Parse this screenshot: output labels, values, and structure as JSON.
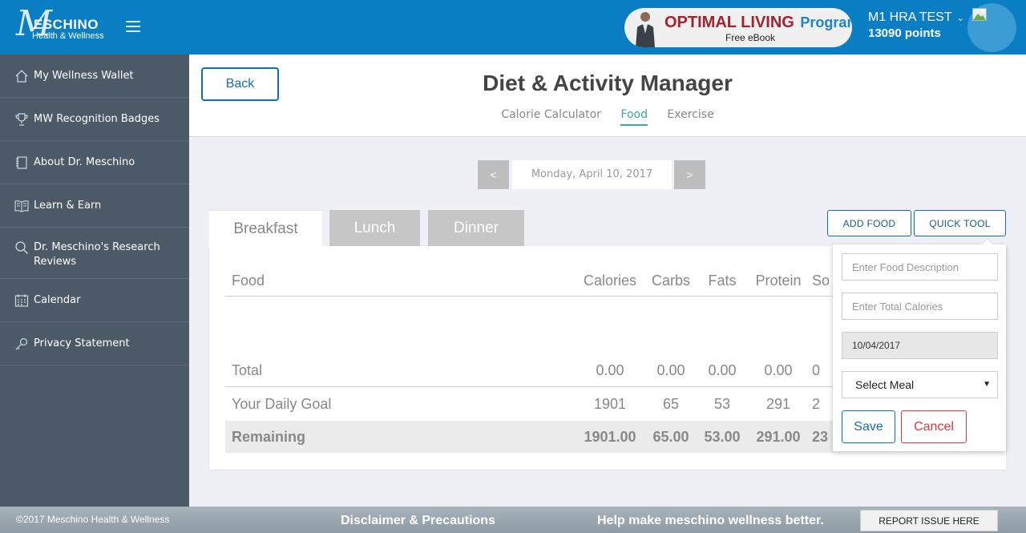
{
  "header": {
    "logo_brand": "ESCHINO",
    "logo_initial": "M",
    "logo_sub": "Health & Wellness",
    "promo_title": "OPTIMAL LIVING",
    "promo_program": "Program",
    "promo_ebook": "Free eBook",
    "user_name": "M1 HRA TEST",
    "user_points": "13090 points"
  },
  "sidebar": {
    "items": [
      {
        "label": "My Wellness Wallet",
        "icon": "home-icon"
      },
      {
        "label": "MW Recognition Badges",
        "icon": "trophy-icon"
      },
      {
        "label": "About Dr. Meschino",
        "icon": "book-icon"
      },
      {
        "label": "Learn & Earn",
        "icon": "open-book-icon"
      },
      {
        "label": "Dr. Meschino's Research Reviews",
        "icon": "search-icon"
      },
      {
        "label": "Calendar",
        "icon": "calendar-icon"
      },
      {
        "label": "Privacy Statement",
        "icon": "key-icon"
      }
    ]
  },
  "page": {
    "back_label": "Back",
    "title": "Diet & Activity Manager",
    "tabs": [
      "Calorie Calculator",
      "Food",
      "Exercise"
    ],
    "active_tab": "Food"
  },
  "date_nav": {
    "prev": "<",
    "next": ">",
    "date": "Monday, April 10, 2017"
  },
  "meals": {
    "tabs": [
      "Breakfast",
      "Lunch",
      "Dinner"
    ],
    "add_food": "ADD FOOD",
    "quick_tool": "QUICK TOOL"
  },
  "table": {
    "headers": [
      "Food",
      "Calories",
      "Carbs",
      "Fats",
      "Protein",
      "So"
    ],
    "total": {
      "label": "Total",
      "values": [
        "0.00",
        "0.00",
        "0.00",
        "0.00",
        "0"
      ]
    },
    "goal": {
      "label": "Your Daily Goal",
      "values": [
        "1901",
        "65",
        "53",
        "291",
        "2"
      ]
    },
    "remaining": {
      "label": "Remaining",
      "values": [
        "1901.00",
        "65.00",
        "53.00",
        "291.00",
        "23"
      ]
    }
  },
  "quick_tool": {
    "food_placeholder": "Enter Food Description",
    "calories_placeholder": "Enter Total Calories",
    "date_value": "10/04/2017",
    "meal_select": "Select Meal",
    "save": "Save",
    "cancel": "Cancel"
  },
  "footer": {
    "copyright": "©2017 Meschino Health & Wellness",
    "disclaimer": "Disclaimer & Precautions",
    "help": "Help make meschino wellness better.",
    "report": "REPORT ISSUE HERE"
  },
  "colors": {
    "header_blue": "#0a7ec2",
    "sidebar": "#4c5a68",
    "active_tab": "#3aa997",
    "primary_button": "#1470a8",
    "cancel": "#d6383f"
  }
}
